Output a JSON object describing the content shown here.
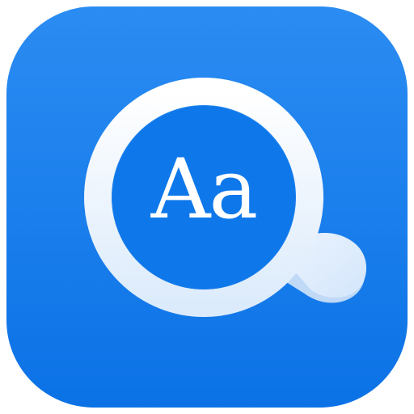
{
  "app_icon": {
    "name": "dictionary-search-icon",
    "text": "Aa",
    "colors": {
      "background_top": "#2B8CF2",
      "background_bottom": "#0B72E6",
      "lens_ring_top": "#FFFFFF",
      "lens_ring_bottom": "#DCEBFB",
      "handle_light": "#EAF3FE",
      "handle_shadow": "#BFD9F7",
      "glyph": "#FFFFFF"
    }
  }
}
